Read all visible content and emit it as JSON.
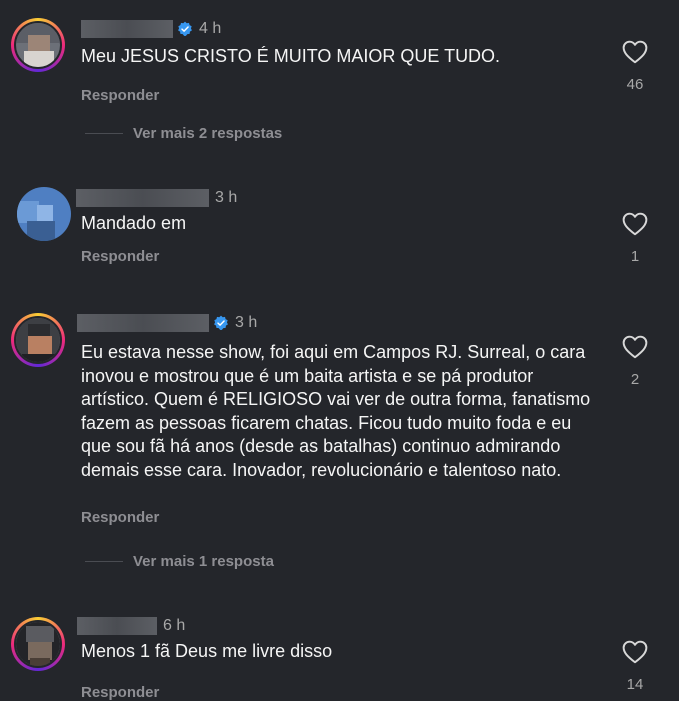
{
  "comments": [
    {
      "time": "4 h",
      "verified": true,
      "text": "Meu JESUS CRISTO É MUITO MAIOR QUE TUDO.",
      "reply_label": "Responder",
      "likes": "46",
      "view_more": "Ver mais 2 respostas"
    },
    {
      "time": "3 h",
      "verified": false,
      "text": "Mandado em",
      "reply_label": "Responder",
      "likes": "1"
    },
    {
      "time": "3 h",
      "verified": true,
      "text": "Eu estava nesse show, foi aqui em Campos RJ. Surreal, o cara inovou e mostrou que é um baita artista e se pá produtor artístico. Quem é RELIGIOSO vai ver de outra forma, fanatismo fazem as pessoas ficarem chatas. Ficou tudo muito foda e eu que sou fã há anos (desde as batalhas) continuo admirando demais esse cara. Inovador, revolucionário e talentoso nato.",
      "reply_label": "Responder",
      "likes": "2",
      "view_more": "Ver mais 1 resposta"
    },
    {
      "time": "6 h",
      "verified": false,
      "text": "Menos 1 fã Deus me livre disso",
      "reply_label": "Responder",
      "likes": "14"
    }
  ],
  "icons": {
    "like": "heart-outline-icon",
    "verified": "verified-badge-icon"
  },
  "colors": {
    "background": "#24262b",
    "text": "#f5f5f5",
    "secondary": "#8e8e93",
    "verified": "#3797f0"
  }
}
